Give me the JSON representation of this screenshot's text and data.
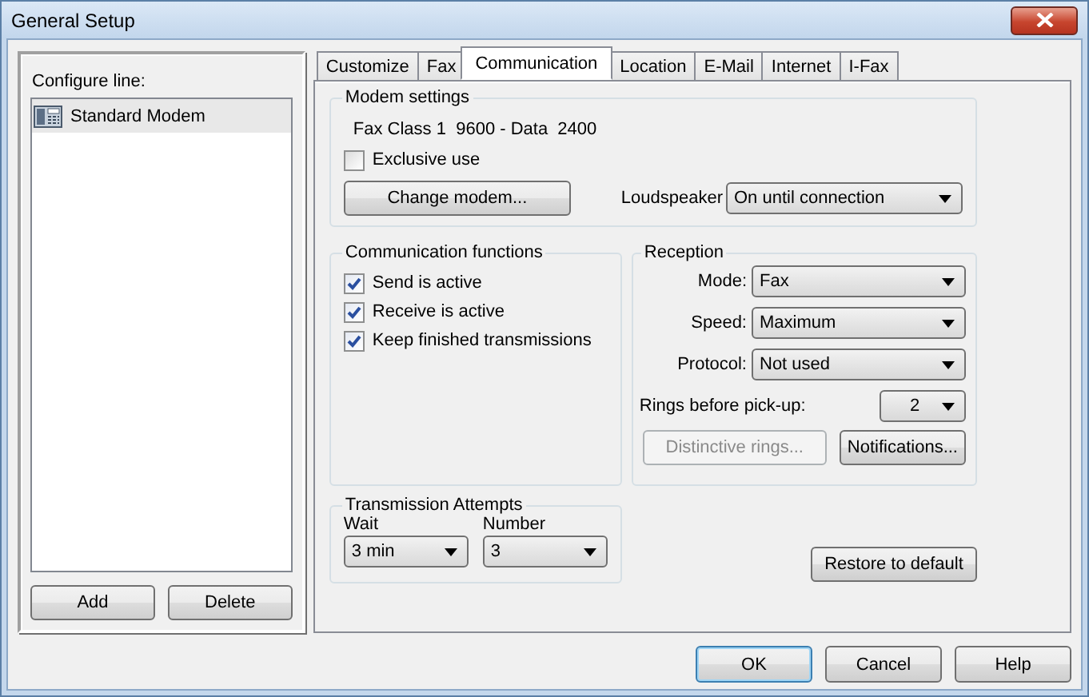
{
  "window": {
    "title": "General Setup"
  },
  "left_panel": {
    "label": "Configure line:",
    "items": [
      {
        "name": "Standard Modem",
        "selected": true
      }
    ],
    "buttons": [
      "Add",
      "Delete"
    ]
  },
  "tabs": [
    {
      "label": "Customize",
      "selected": false
    },
    {
      "label": "Fax",
      "selected": false
    },
    {
      "label": "Communication",
      "selected": true
    },
    {
      "label": "Location",
      "selected": false
    },
    {
      "label": "E-Mail",
      "selected": false
    },
    {
      "label": "Internet",
      "selected": false
    },
    {
      "label": "I-Fax",
      "selected": false
    }
  ],
  "modem_settings": {
    "title": "Modem settings",
    "description": "Fax Class 1  9600 - Data  2400",
    "exclusive_use": {
      "label": "Exclusive use",
      "checked": false
    },
    "change_button": "Change modem...",
    "loudspeaker": {
      "label": "Loudspeaker",
      "value": "On until connection"
    }
  },
  "communication_functions": {
    "title": "Communication functions",
    "items": [
      {
        "label": "Send is active",
        "checked": true
      },
      {
        "label": "Receive is active",
        "checked": true
      },
      {
        "label": "Keep finished transmissions",
        "checked": true
      }
    ]
  },
  "reception": {
    "title": "Reception",
    "fields": [
      {
        "label": "Mode:",
        "value": "Fax"
      },
      {
        "label": "Speed:",
        "value": "Maximum"
      },
      {
        "label": "Protocol:",
        "value": "Not used"
      }
    ],
    "rings": {
      "label": "Rings before pick-up:",
      "value": "2"
    },
    "buttons": [
      {
        "label": "Distinctive rings...",
        "disabled": true
      },
      {
        "label": "Notifications...",
        "disabled": false
      }
    ]
  },
  "transmission_attempts": {
    "title": "Transmission Attempts",
    "fields": [
      {
        "label": "Wait",
        "value": "3 min"
      },
      {
        "label": "Number",
        "value": "3"
      }
    ]
  },
  "restore_button": "Restore to default",
  "dialog_buttons": [
    {
      "label": "OK",
      "default": true
    },
    {
      "label": "Cancel",
      "default": false
    },
    {
      "label": "Help",
      "default": false
    }
  ]
}
